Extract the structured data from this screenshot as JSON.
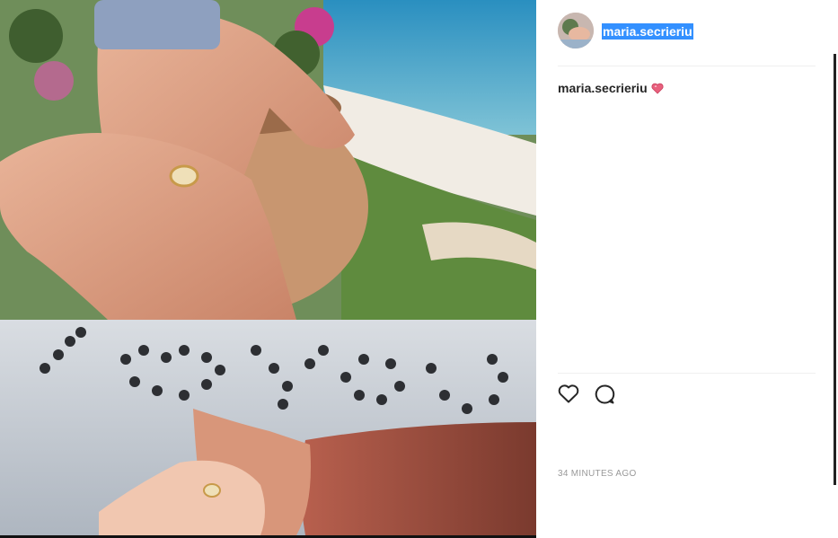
{
  "post": {
    "image_alt": "Engagement ring photo collage",
    "username_header": "maria.secrieriu",
    "caption_username": "maria.secrieriu",
    "caption_emoji": "heart",
    "timestamp": "34 minutes ago"
  },
  "icons": {
    "like": "heart-outline-icon",
    "comment": "comment-bubble-icon"
  },
  "colors": {
    "selection": "#3390ff",
    "text": "#262626",
    "muted": "#999999",
    "divider": "#efefef",
    "emoji_heart": "#e8607d"
  }
}
